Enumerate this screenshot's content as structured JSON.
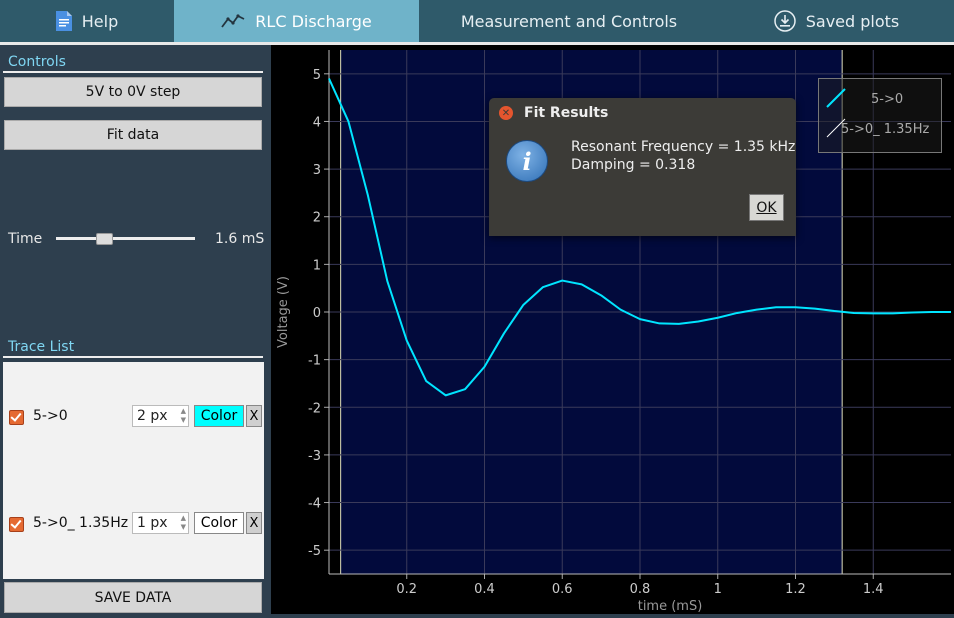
{
  "tabs": [
    {
      "label": "Help",
      "icon": "document-icon"
    },
    {
      "label": "RLC Discharge",
      "icon": "chart-line-icon",
      "active": true
    },
    {
      "label": "Measurement and Controls"
    },
    {
      "label": "Saved plots",
      "icon": "download-icon"
    }
  ],
  "controls": {
    "title": "Controls",
    "step_button": "5V to 0V step",
    "fit_button": "Fit data",
    "time_label": "Time",
    "time_value": "1.6 mS",
    "time_fraction": 0.34
  },
  "trace_list": {
    "title": "Trace List",
    "items": [
      {
        "name": "5->0",
        "width": "2 px",
        "color_label": "Color",
        "x_label": "X",
        "color": "#00ffff"
      },
      {
        "name": "5->0_ 1.35Hz",
        "width": "1 px",
        "color_label": "Color",
        "x_label": "X",
        "color": "#ffffff"
      }
    ]
  },
  "save_button": "SAVE DATA",
  "dialog": {
    "title": "Fit Results",
    "line1": "Resonant Frequency =  1.35 kHz",
    "line2": "Damping = 0.318",
    "ok": "OK"
  },
  "chart_data": {
    "type": "line",
    "xlabel": "time (mS)",
    "ylabel": "Voltage (V)",
    "xlim": [
      0,
      1.6
    ],
    "ylim": [
      -5.5,
      5.5
    ],
    "xticks": [
      "0.2",
      "0.4",
      "0.6",
      "0.8",
      "1",
      "1.2",
      "1.4"
    ],
    "yticks": [
      "5",
      "4",
      "3",
      "2",
      "1",
      "0",
      "-1",
      "-2",
      "-3",
      "-4",
      "-5"
    ],
    "grid": true,
    "legend": "top-right",
    "region": [
      0.03,
      1.32
    ],
    "series": [
      {
        "name": "5->0",
        "color": "#00e5ff",
        "x": [
          0,
          0.05,
          0.1,
          0.15,
          0.2,
          0.25,
          0.3,
          0.35,
          0.4,
          0.45,
          0.5,
          0.55,
          0.6,
          0.65,
          0.7,
          0.75,
          0.8,
          0.85,
          0.9,
          0.95,
          1.0,
          1.05,
          1.1,
          1.15,
          1.2,
          1.25,
          1.3,
          1.35,
          1.4,
          1.45,
          1.5,
          1.55,
          1.6
        ],
        "y": [
          4.9,
          4.0,
          2.45,
          0.65,
          -0.6,
          -1.45,
          -1.75,
          -1.62,
          -1.15,
          -0.45,
          0.15,
          0.52,
          0.66,
          0.58,
          0.35,
          0.05,
          -0.15,
          -0.24,
          -0.25,
          -0.2,
          -0.12,
          -0.02,
          0.05,
          0.1,
          0.1,
          0.07,
          0.02,
          -0.02,
          -0.03,
          -0.03,
          -0.01,
          0.0,
          0.0
        ]
      },
      {
        "name": "5->0_ 1.35Hz",
        "color": "#ffffff",
        "x": [
          0,
          0.05,
          0.1,
          0.15,
          0.2,
          0.25,
          0.3,
          0.35,
          0.4,
          0.45,
          0.5,
          0.55,
          0.6,
          0.65,
          0.7,
          0.75,
          0.8,
          0.85,
          0.9,
          0.95,
          1.0,
          1.05,
          1.1,
          1.15,
          1.2,
          1.25,
          1.3,
          1.35,
          1.4,
          1.45,
          1.5,
          1.55,
          1.6
        ],
        "y": [
          4.9,
          4.0,
          2.45,
          0.65,
          -0.6,
          -1.45,
          -1.75,
          -1.62,
          -1.15,
          -0.45,
          0.15,
          0.52,
          0.66,
          0.58,
          0.35,
          0.05,
          -0.15,
          -0.24,
          -0.25,
          -0.2,
          -0.12,
          -0.02,
          0.05,
          0.1,
          0.1,
          0.07,
          0.02,
          -0.02,
          -0.03,
          -0.03,
          -0.01,
          0.0,
          0.0
        ]
      }
    ]
  }
}
